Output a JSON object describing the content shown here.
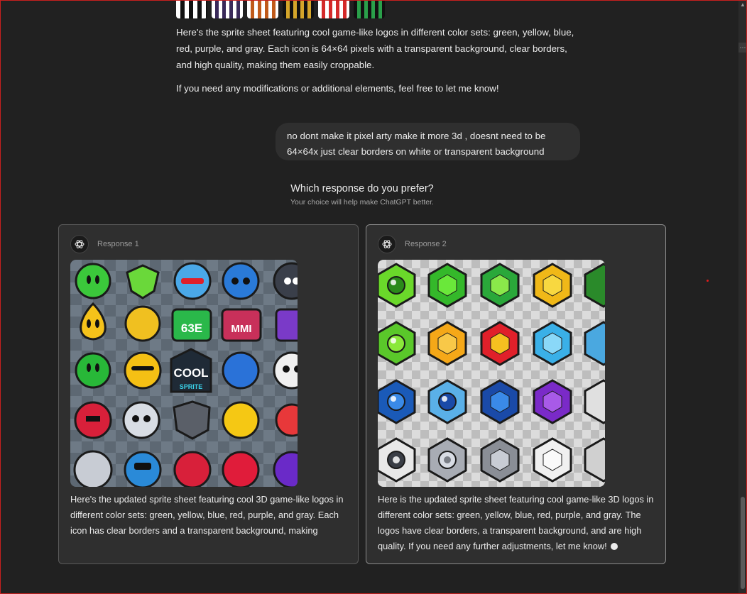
{
  "assistant_message": {
    "paragraph_1": "Here's the sprite sheet featuring cool game-like logos in different color sets: green, yellow, blue, red, purple, and gray. Each icon is 64×64 pixels with a transparent background, clear borders, and high quality, making them easily croppable.",
    "paragraph_2": "If you need any modifications or additional elements, feel free to let me know!"
  },
  "user_message": "no dont make it pixel arty make it more 3d , doesnt need to be 64×64x just clear borders on white or transparent background",
  "comparison": {
    "title": "Which response do you prefer?",
    "subtitle": "Your choice will help make ChatGPT better."
  },
  "responses": [
    {
      "label": "Response 1",
      "text": "Here's the updated sprite sheet featuring cool 3D game-like logos in different color sets: green, yellow, blue, red, purple, and gray. Each icon has clear borders and a transparent background, making",
      "sprite_text": {
        "word1": "COOL",
        "word2": "SPRITE",
        "word3": "63E",
        "word4": "MMI"
      }
    },
    {
      "label": "Response 2",
      "text": "Here is the updated sprite sheet featuring cool game-like 3D logos in different color sets: green, yellow, blue, red, purple, and gray. The logos have clear borders, a transparent background, and are high quality. If you need any further adjustments, let me know!"
    }
  ],
  "colors": {
    "background": "#212121",
    "card": "#2f2f2f",
    "bubble": "#2f2f2f",
    "text": "#ececec",
    "muted": "#a8a8a8",
    "frame": "#c8201f"
  },
  "icons": [
    "openai-logo-icon",
    "scroll-up-icon",
    "more-dots-icon",
    "status-dot-icon"
  ]
}
